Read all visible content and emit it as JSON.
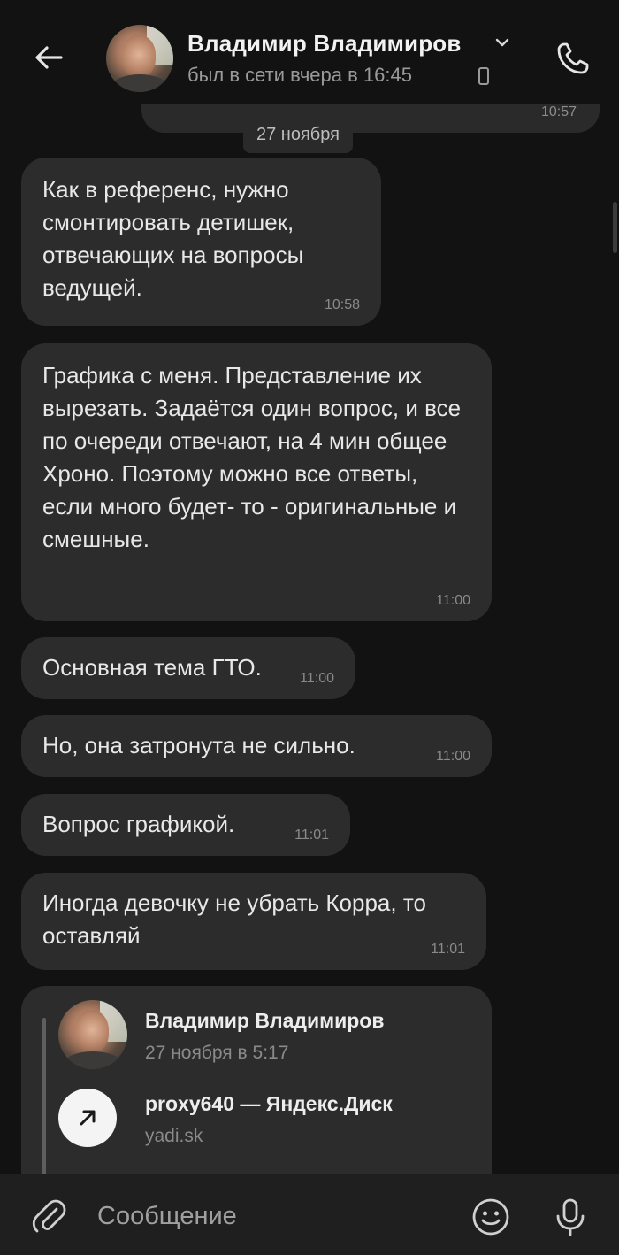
{
  "header": {
    "contact_name": "Владимир Владимиров",
    "status": "был в сети вчера в 16:45"
  },
  "previous_message": {
    "time": "10:57"
  },
  "date_separator": "27 ноября",
  "messages": [
    {
      "text": "Как в референс, нужно смонтировать детишек, отвечающих на вопросы ведущей.",
      "time": "10:58"
    },
    {
      "text": "Графика с меня. Представление их вырезать. Задаётся один вопрос, и все по очереди отвечают, на 4 мин общее Хроно. Поэтому можно все ответы, если много будет- то - оригинальные и смешные.",
      "time": "11:00"
    },
    {
      "text": "Основная тема ГТО.",
      "time": "11:00"
    },
    {
      "text": "Но, она затронута не сильно.",
      "time": "11:00"
    },
    {
      "text": "Вопрос графикой.",
      "time": "11:01"
    },
    {
      "text": "Иногда девочку не убрать Корра, то оставляй",
      "time": "11:01"
    }
  ],
  "forwarded": {
    "author": "Владимир Владимиров",
    "date": "27 ноября в 5:17",
    "link_title": "proxy640 — Яндекс.Диск",
    "link_domain": "yadi.sk"
  },
  "composer": {
    "placeholder": "Сообщение"
  },
  "icons": {
    "back": "arrow-left-icon",
    "call": "phone-icon",
    "attach": "paperclip-icon",
    "emoji": "smile-icon",
    "mic": "microphone-icon",
    "link": "arrow-up-right-icon"
  },
  "colors": {
    "background": "#121212",
    "bubble": "#2c2c2c",
    "text": "#e8e8e8",
    "muted": "#8a8a8a"
  }
}
